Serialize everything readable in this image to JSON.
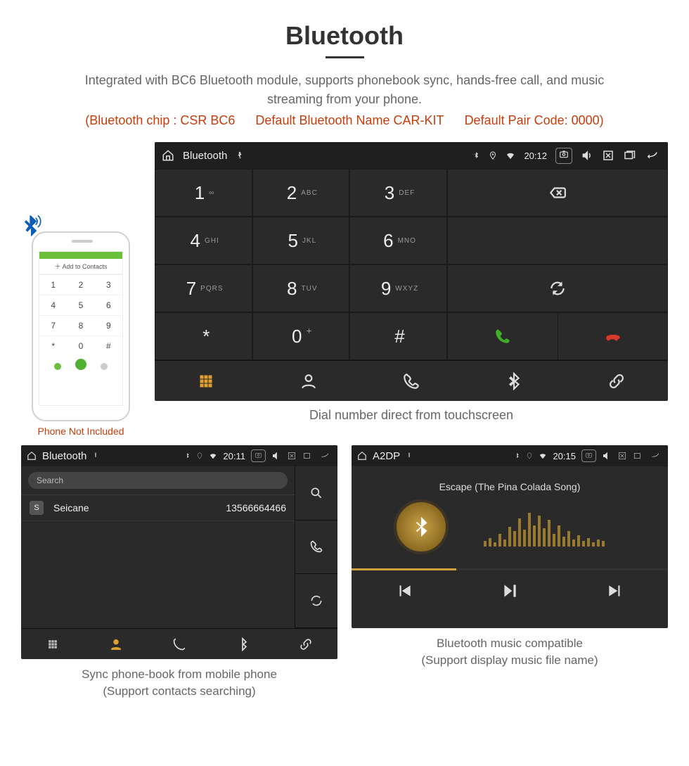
{
  "title": "Bluetooth",
  "lead": "Integrated with BC6 Bluetooth module, supports phonebook sync, hands-free call, and music streaming from your phone.",
  "params": {
    "chip": "(Bluetooth chip : CSR BC6",
    "name": "Default Bluetooth Name CAR-KIT",
    "code": "Default Pair Code: 0000)"
  },
  "phone_caption": "Phone Not Included",
  "phone_screen": {
    "header": "Add to Contacts"
  },
  "dialer": {
    "status": {
      "title": "Bluetooth",
      "time": "20:12"
    },
    "keys": [
      {
        "n": "1",
        "s": "∞"
      },
      {
        "n": "2",
        "s": "ABC"
      },
      {
        "n": "3",
        "s": "DEF"
      },
      {
        "n": "4",
        "s": "GHI"
      },
      {
        "n": "5",
        "s": "JKL"
      },
      {
        "n": "6",
        "s": "MNO"
      },
      {
        "n": "7",
        "s": "PQRS"
      },
      {
        "n": "8",
        "s": "TUV"
      },
      {
        "n": "9",
        "s": "WXYZ"
      },
      {
        "n": "*",
        "s": ""
      },
      {
        "n": "0",
        "s": "+",
        "suptop": true
      },
      {
        "n": "#",
        "s": ""
      }
    ],
    "caption": "Dial number direct from touchscreen"
  },
  "phonebook": {
    "status": {
      "title": "Bluetooth",
      "time": "20:11"
    },
    "search_placeholder": "Search",
    "entry": {
      "tag": "S",
      "name": "Seicane",
      "number": "13566664466"
    },
    "caption1": "Sync phone-book from mobile phone",
    "caption2": "(Support contacts searching)"
  },
  "music": {
    "status": {
      "title": "A2DP",
      "time": "20:15"
    },
    "track": "Escape (The Pina Colada Song)",
    "caption1": "Bluetooth music compatible",
    "caption2": "(Support display music file name)"
  }
}
